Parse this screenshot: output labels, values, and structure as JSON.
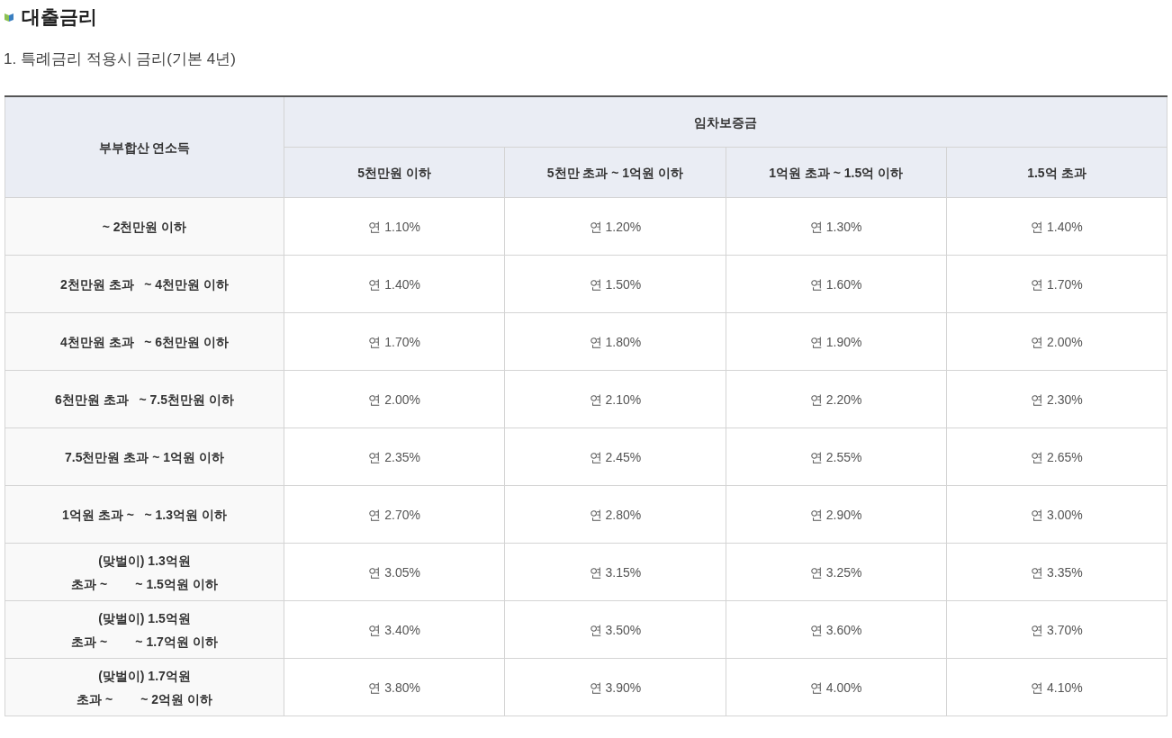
{
  "heading": "대출금리",
  "subheading": "1. 특례금리 적용시 금리(기본 4년)",
  "table": {
    "row_header": "부부합산 연소득",
    "group_header": "임차보증금",
    "columns": [
      "5천만원 이하",
      "5천만 초과 ~ 1억원 이하",
      "1억원 초과 ~ 1.5억 이하",
      "1.5억 초과"
    ],
    "rows": [
      {
        "label": [
          "~ 2천만원 이하"
        ],
        "cells": [
          "연 1.10%",
          "연 1.20%",
          "연 1.30%",
          "연 1.40%"
        ]
      },
      {
        "label": [
          "2천만원 초과   ~ 4천만원 이하"
        ],
        "cells": [
          "연 1.40%",
          "연 1.50%",
          "연 1.60%",
          "연 1.70%"
        ]
      },
      {
        "label": [
          "4천만원 초과   ~ 6천만원 이하"
        ],
        "cells": [
          "연 1.70%",
          "연 1.80%",
          "연 1.90%",
          "연 2.00%"
        ]
      },
      {
        "label": [
          "6천만원 초과   ~ 7.5천만원 이하"
        ],
        "cells": [
          "연 2.00%",
          "연 2.10%",
          "연 2.20%",
          "연 2.30%"
        ]
      },
      {
        "label": [
          "7.5천만원 초과 ~ 1억원 이하"
        ],
        "cells": [
          "연 2.35%",
          "연 2.45%",
          "연 2.55%",
          "연 2.65%"
        ]
      },
      {
        "label": [
          "1억원 초과 ~   ~ 1.3억원 이하"
        ],
        "cells": [
          "연 2.70%",
          "연 2.80%",
          "연 2.90%",
          "연 3.00%"
        ]
      },
      {
        "label": [
          "(맞벌이) 1.3억원",
          "초과 ~        ~ 1.5억원 이하"
        ],
        "cells": [
          "연 3.05%",
          "연 3.15%",
          "연 3.25%",
          "연 3.35%"
        ]
      },
      {
        "label": [
          "(맞벌이) 1.5억원",
          "초과 ~        ~ 1.7억원 이하"
        ],
        "cells": [
          "연 3.40%",
          "연 3.50%",
          "연 3.60%",
          "연 3.70%"
        ]
      },
      {
        "label": [
          "(맞벌이) 1.7억원",
          "초과 ~        ~ 2억원 이하"
        ],
        "cells": [
          "연 3.80%",
          "연 3.90%",
          "연 4.00%",
          "연 4.10%"
        ]
      }
    ]
  }
}
